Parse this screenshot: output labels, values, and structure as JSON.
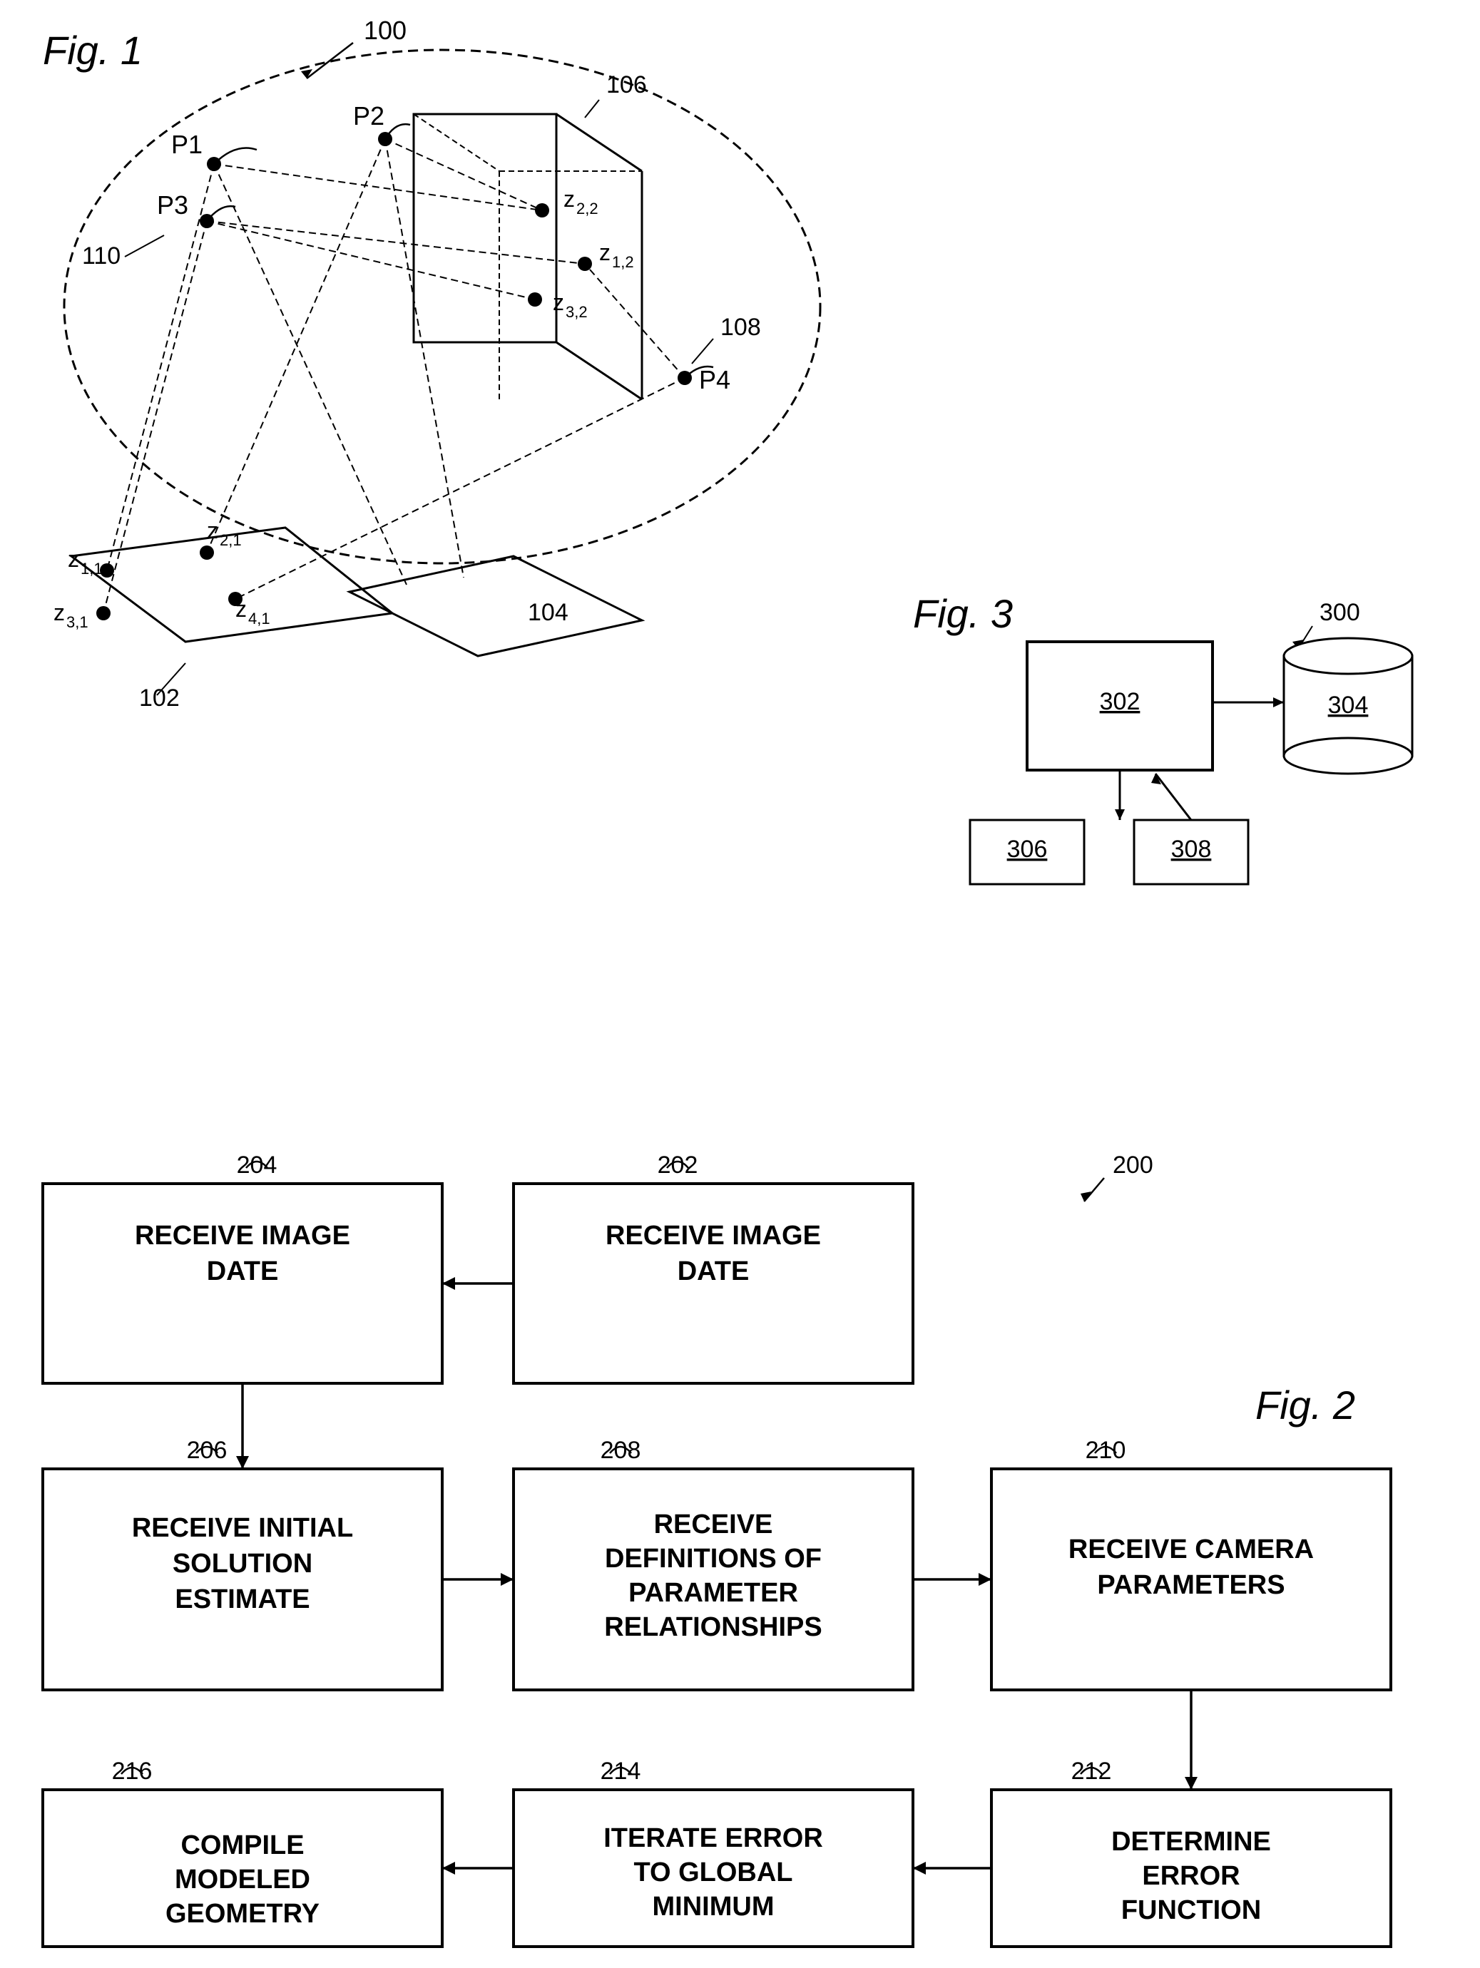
{
  "fig1": {
    "label": "Fig. 1",
    "ref": "100",
    "points": [
      "P1",
      "P2",
      "P3",
      "P4"
    ],
    "refs": [
      "102",
      "104",
      "106",
      "108",
      "110"
    ],
    "z_labels_left": [
      "z₁,₁",
      "z₂,₁",
      "z₃,₁",
      "z₄,₁"
    ],
    "z_labels_right": [
      "z₁,₂",
      "z₂,₂",
      "z₃,₂"
    ]
  },
  "fig3": {
    "label": "Fig. 3",
    "ref": "300",
    "box_302": "302",
    "box_304": "304",
    "box_306": "306",
    "box_308": "308"
  },
  "fig2": {
    "label": "Fig. 2",
    "ref": "200",
    "nodes": {
      "n202": {
        "ref": "202",
        "text": "RECEIVE IMAGE DATE"
      },
      "n204": {
        "ref": "204",
        "text": "RECEIVE IMAGE DATE"
      },
      "n206": {
        "ref": "206",
        "text": "RECEIVE INITIAL SOLUTION ESTIMATE"
      },
      "n208": {
        "ref": "208",
        "text": "RECEIVE DEFINITIONS OF PARAMETER RELATIONSHIPS"
      },
      "n210": {
        "ref": "210",
        "text": "RECEIVE CAMERA PARAMETERS"
      },
      "n212": {
        "ref": "212",
        "text": "DETERMINE ERROR FUNCTION"
      },
      "n214": {
        "ref": "214",
        "text": "ITERATE ERROR TO GLOBAL MINIMUM"
      },
      "n216": {
        "ref": "216",
        "text": "COMPILE MODELED GEOMETRY"
      }
    }
  }
}
